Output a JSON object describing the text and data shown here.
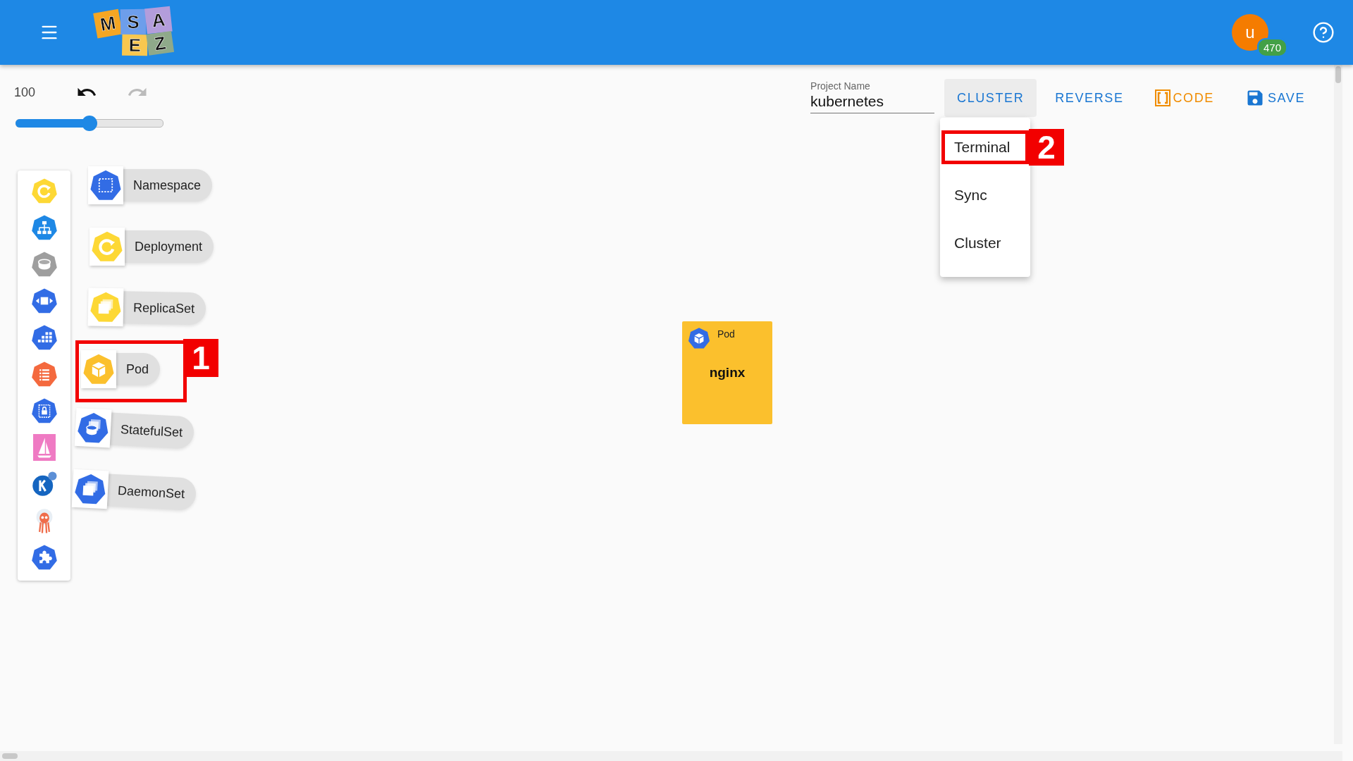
{
  "header": {
    "logo": {
      "tiles": [
        {
          "letter": "M",
          "color": "#f5a623"
        },
        {
          "letter": "S",
          "color": "#6d9eeb"
        },
        {
          "letter": "A",
          "color": "#b39ddb"
        },
        {
          "letter": "E",
          "color": "#f9c74f"
        },
        {
          "letter": "Z",
          "color": "#8fa98a"
        }
      ]
    },
    "avatar_letter": "u",
    "badge": "470"
  },
  "zoom": {
    "value": "100",
    "level": 0.5,
    "undo_disabled": false,
    "redo_disabled": true
  },
  "project": {
    "label": "Project Name",
    "value": "kubernetes"
  },
  "toolbar": [
    {
      "label": "CLUSTER",
      "kind": "text",
      "selected": true,
      "color": "#1976d2"
    },
    {
      "label": "REVERSE",
      "kind": "text",
      "selected": false,
      "color": "#1976d2"
    },
    {
      "label": "CODE",
      "kind": "code",
      "selected": false,
      "color": "#f08c00"
    },
    {
      "label": "SAVE",
      "kind": "save",
      "selected": false,
      "color": "#1976d2"
    }
  ],
  "cluster_menu": {
    "open": true,
    "items": [
      {
        "label": "Terminal",
        "annotation": "2"
      },
      {
        "label": "Sync"
      },
      {
        "label": "Cluster"
      }
    ]
  },
  "palette": [
    {
      "label": "Namespace"
    },
    {
      "label": "Deployment"
    },
    {
      "label": "ReplicaSet"
    },
    {
      "label": "Pod",
      "annotation": "1"
    },
    {
      "label": "StatefulSet"
    },
    {
      "label": "DaemonSet"
    }
  ],
  "canvas": {
    "nodes": [
      {
        "type": "Pod",
        "name": "nginx"
      }
    ]
  }
}
